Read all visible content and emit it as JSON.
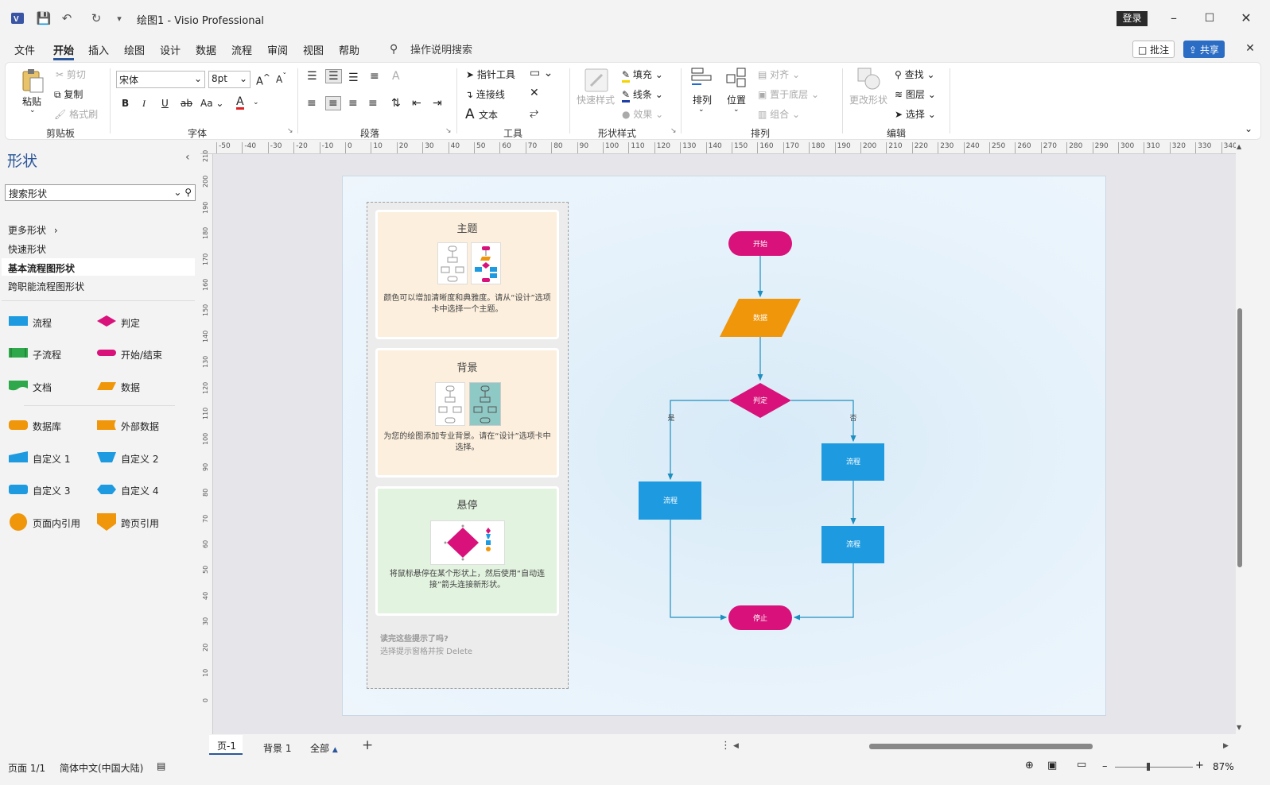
{
  "titlebar": {
    "title": "绘图1  -  Visio Professional",
    "login": "登录",
    "app_icon": "visio-icon"
  },
  "menu": {
    "items": [
      "文件",
      "开始",
      "插入",
      "绘图",
      "设计",
      "数据",
      "流程",
      "审阅",
      "视图",
      "帮助"
    ],
    "active": "开始",
    "tellme": "操作说明搜索",
    "comment": "批注",
    "share": "共享"
  },
  "ribbon": {
    "clipboard": {
      "label": "剪贴板",
      "paste": "粘贴",
      "cut": "剪切",
      "copy": "复制",
      "format_painter": "格式刷"
    },
    "font": {
      "label": "字体",
      "family": "宋体",
      "size": "8pt",
      "case": "Aa"
    },
    "paragraph": {
      "label": "段落"
    },
    "tools": {
      "label": "工具",
      "pointer": "指针工具",
      "connector": "连接线",
      "text": "文本"
    },
    "shape_styles": {
      "label": "形状样式",
      "quick": "快速样式",
      "fill": "填充",
      "line": "线条",
      "effects": "效果"
    },
    "arrange": {
      "label": "排列",
      "arrange": "排列",
      "position": "位置",
      "align": "对齐",
      "send_back": "置于底层",
      "group": "组合"
    },
    "editing": {
      "label": "编辑",
      "change_shape": "更改形状",
      "find": "查找",
      "layers": "图层",
      "select": "选择"
    }
  },
  "shapes_panel": {
    "title": "形状",
    "search_placeholder": "搜索形状",
    "nav": [
      "更多形状",
      "快速形状",
      "基本流程图形状",
      "跨职能流程图形状"
    ],
    "selected": "基本流程图形状",
    "items": [
      {
        "label": "流程",
        "color": "#1e9be0"
      },
      {
        "label": "判定",
        "color": "#d8127a"
      },
      {
        "label": "子流程",
        "color": "#2ea84a"
      },
      {
        "label": "开始/结束",
        "color": "#d8127a"
      },
      {
        "label": "文档",
        "color": "#2ea84a"
      },
      {
        "label": "数据",
        "color": "#f0960a"
      },
      {
        "label": "数据库",
        "color": "#f0960a"
      },
      {
        "label": "外部数据",
        "color": "#f0960a"
      },
      {
        "label": "自定义 1",
        "color": "#1e9be0"
      },
      {
        "label": "自定义 2",
        "color": "#1e9be0"
      },
      {
        "label": "自定义 3",
        "color": "#1e9be0"
      },
      {
        "label": "自定义 4",
        "color": "#1e9be0"
      },
      {
        "label": "页面内引用",
        "color": "#f0960a"
      },
      {
        "label": "跨页引用",
        "color": "#f0960a"
      }
    ]
  },
  "ruler": {
    "h": [
      "-50",
      "-40",
      "-30",
      "-20",
      "-10",
      "0",
      "10",
      "20",
      "30",
      "40",
      "50",
      "60",
      "70",
      "80",
      "90",
      "100",
      "110",
      "120",
      "130",
      "140",
      "150",
      "160",
      "170",
      "180",
      "190",
      "200",
      "210",
      "220",
      "230",
      "240",
      "250",
      "260",
      "270",
      "280",
      "290",
      "300",
      "310",
      "320",
      "330",
      "340"
    ],
    "v": [
      "210",
      "200",
      "190",
      "180",
      "170",
      "160",
      "150",
      "140",
      "130",
      "120",
      "110",
      "100",
      "90",
      "80",
      "70",
      "60",
      "50",
      "40",
      "30",
      "20",
      "10",
      "0"
    ]
  },
  "tips": {
    "theme": {
      "title": "主题",
      "text": "颜色可以增加清晰度和典雅度。请从“设计”选项卡中选择一个主题。"
    },
    "background": {
      "title": "背景",
      "text": "为您的绘图添加专业背景。请在“设计”选项卡中选择。"
    },
    "hover": {
      "title": "悬停",
      "text": "将鼠标悬停在某个形状上，然后使用“自动连接”箭头连接新形状。"
    },
    "done_title": "读完这些提示了吗?",
    "done_text": "选择提示窗格并按 Delete"
  },
  "flow": {
    "start": "开始",
    "data": "数据",
    "decision": "判定",
    "yes": "是",
    "no": "否",
    "process1": "流程",
    "process2": "流程",
    "process3": "流程",
    "stop": "停止"
  },
  "colors": {
    "magenta": "#d8127a",
    "orange": "#f0960a",
    "blue": "#1e9be0",
    "line": "#1f8fbf"
  },
  "tabs": {
    "page1": "页-1",
    "background1": "背景 1",
    "all": "全部"
  },
  "status": {
    "page": "页面 1/1",
    "lang": "简体中文(中国大陆)",
    "zoom": "87%"
  }
}
